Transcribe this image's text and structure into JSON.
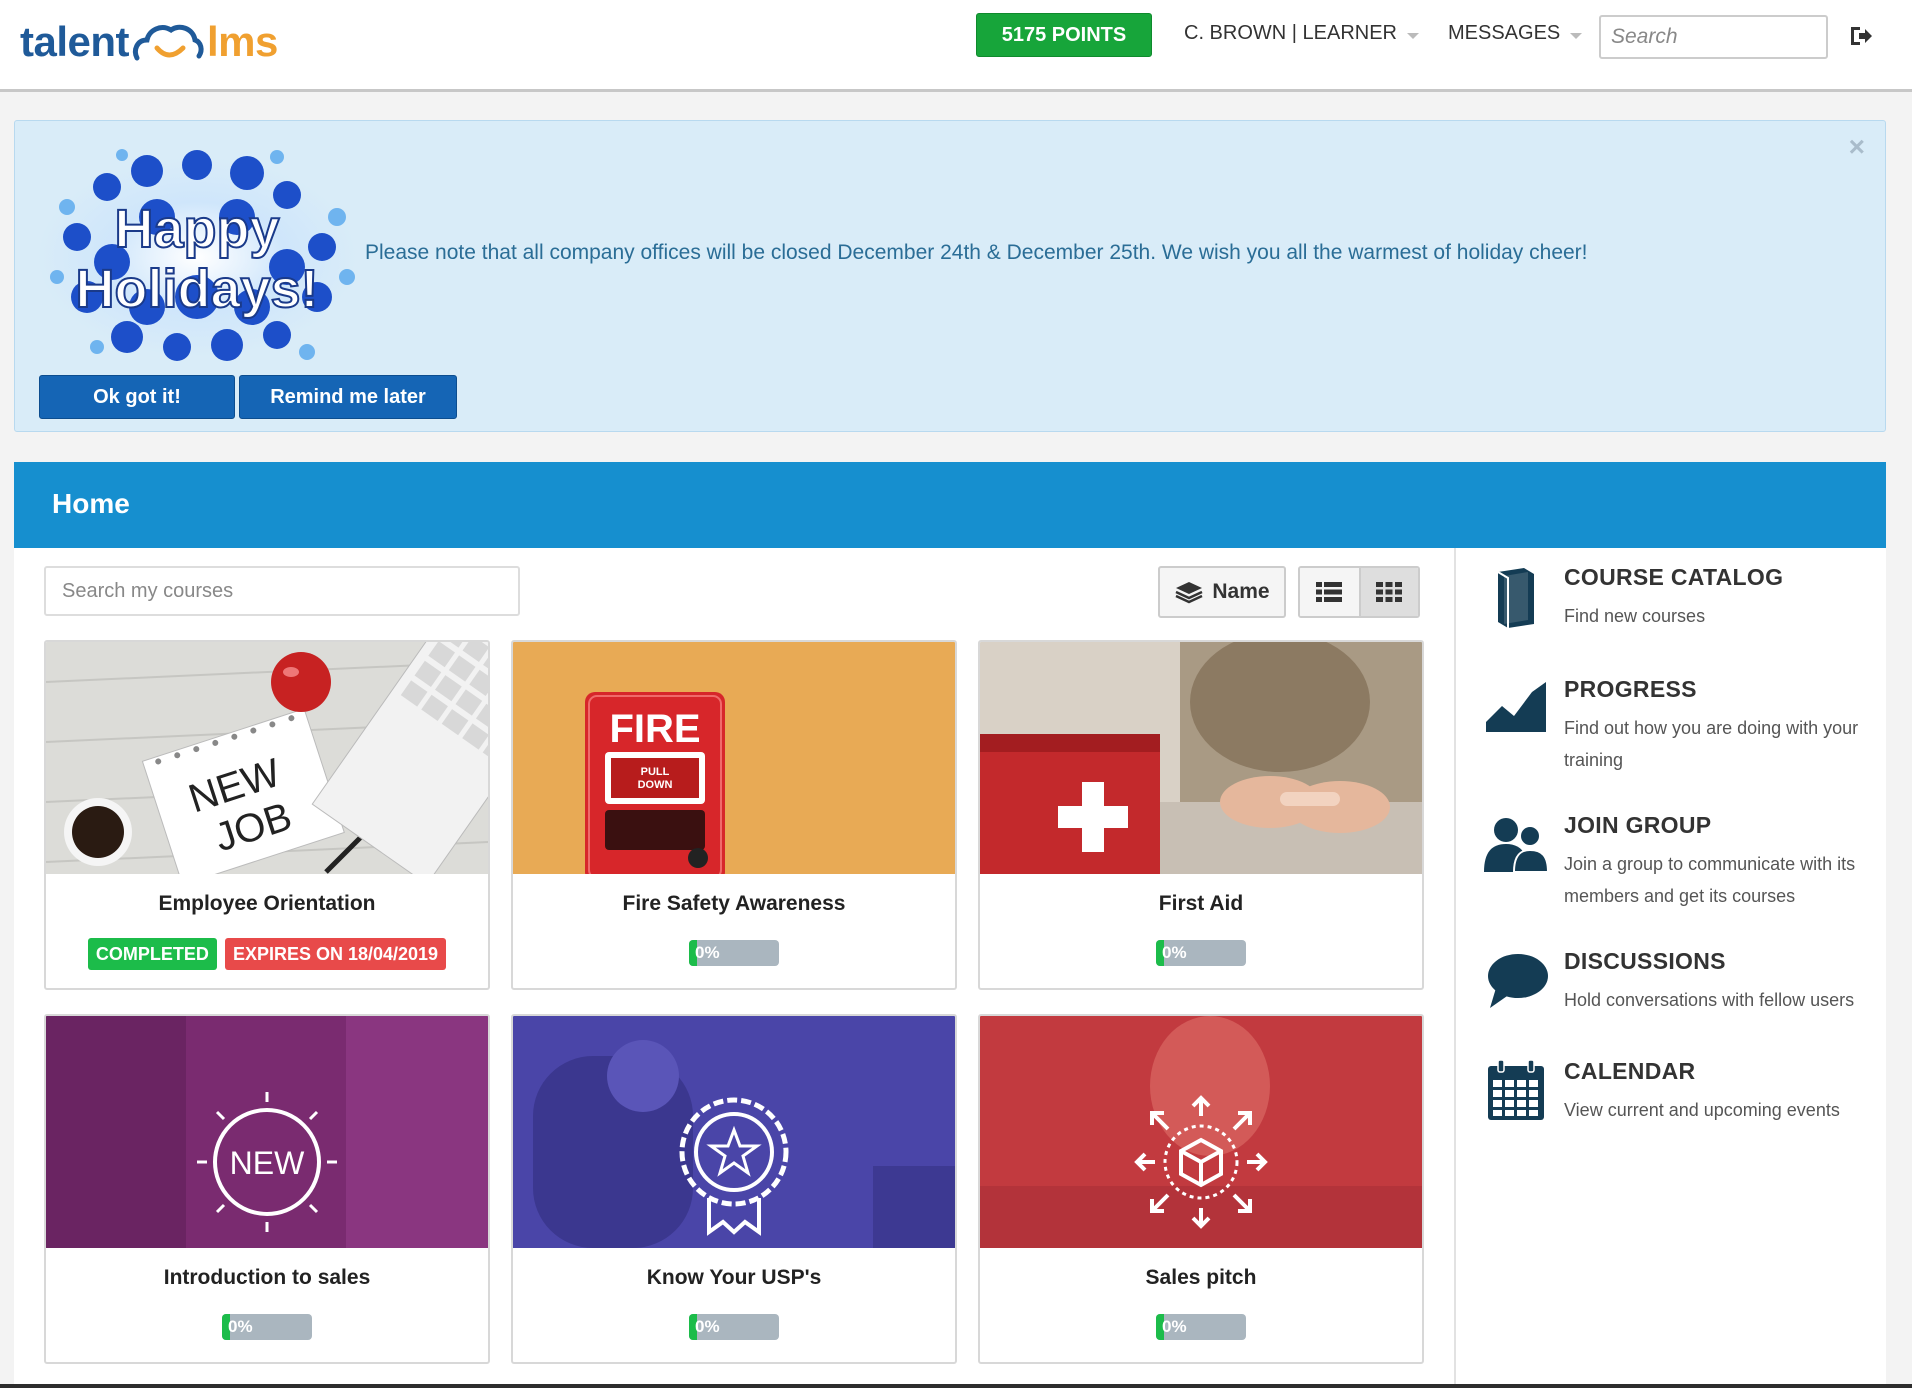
{
  "header": {
    "logo_left": "talent",
    "logo_right": "lms",
    "points_label": "5175 POINTS",
    "user_menu": "C. BROWN | LEARNER",
    "messages_menu": "MESSAGES",
    "search_placeholder": "Search"
  },
  "announcement": {
    "image_text_line1": "Happy",
    "image_text_line2": "Holidays!",
    "message": "Please note that all company offices will be closed December 24th & December 25th. We wish you all the warmest of holiday cheer!",
    "ok_label": "Ok got it!",
    "remind_label": "Remind me later",
    "close_symbol": "×"
  },
  "home": {
    "title": "Home",
    "search_placeholder": "Search my courses",
    "sort_label": "Name"
  },
  "courses": [
    {
      "title": "Employee Orientation",
      "status": "COMPLETED",
      "expires": "EXPIRES ON 18/04/2019",
      "thumb_note1": "NEW",
      "thumb_note2": "JOB"
    },
    {
      "title": "Fire Safety Awareness",
      "progress": "0%",
      "progress_value": 0,
      "thumb_sign": "FIRE",
      "thumb_small1": "PULL",
      "thumb_small2": "DOWN"
    },
    {
      "title": "First Aid",
      "progress": "0%",
      "progress_value": 0
    },
    {
      "title": "Introduction to sales",
      "progress": "0%",
      "progress_value": 0,
      "thumb_text": "NEW"
    },
    {
      "title": "Know Your USP's",
      "progress": "0%",
      "progress_value": 0
    },
    {
      "title": "Sales pitch",
      "progress": "0%",
      "progress_value": 0
    }
  ],
  "sidebar": [
    {
      "title": "COURSE CATALOG",
      "desc": "Find new courses",
      "icon": "book-icon"
    },
    {
      "title": "PROGRESS",
      "desc": "Find out how you are doing with your training",
      "icon": "chart-icon"
    },
    {
      "title": "JOIN GROUP",
      "desc": "Join a group to communicate with its members and get its courses",
      "icon": "group-icon"
    },
    {
      "title": "DISCUSSIONS",
      "desc": "Hold conversations with fellow users",
      "icon": "chat-bubble-icon"
    },
    {
      "title": "CALENDAR",
      "desc": "View current and upcoming events",
      "icon": "calendar-icon"
    }
  ],
  "colors": {
    "brand_blue": "#168fcf",
    "points_green": "#17a53a",
    "completed_green": "#1cbc4a",
    "expires_red": "#e84a4a",
    "icon_navy": "#143c54"
  }
}
